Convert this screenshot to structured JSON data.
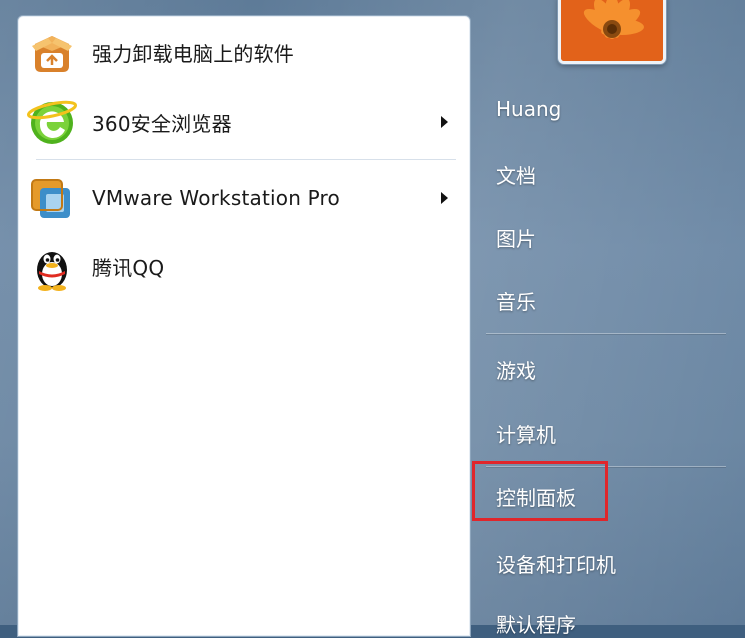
{
  "programs": [
    {
      "label": "强力卸载电脑上的软件",
      "icon": "uninstall-box-icon",
      "has_submenu": false
    },
    {
      "label": "360安全浏览器",
      "icon": "360-browser-icon",
      "has_submenu": true
    },
    {
      "label": "VMware Workstation Pro",
      "icon": "vmware-icon",
      "has_submenu": true
    },
    {
      "label": "腾讯QQ",
      "icon": "qq-penguin-icon",
      "has_submenu": false
    }
  ],
  "right_items": [
    "Huang",
    "文档",
    "图片",
    "音乐",
    "游戏",
    "计算机",
    "控制面板",
    "设备和打印机",
    "默认程序"
  ],
  "highlighted_item": "控制面板",
  "user_picture": "orange-flower-user-picture",
  "colors": {
    "highlight": "#e0262b",
    "left_pane": "#ffffff",
    "right_pane": "#6a86a2"
  }
}
